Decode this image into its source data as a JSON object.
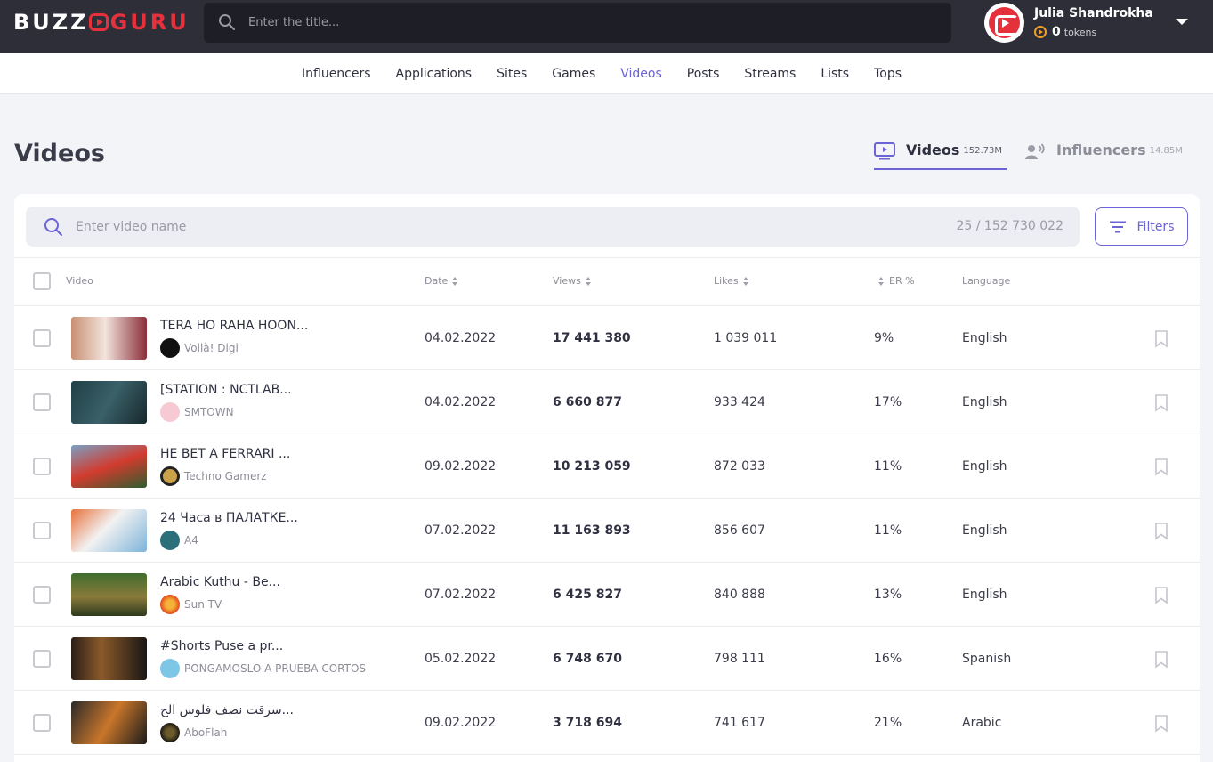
{
  "brand": {
    "part1": "BUZZ",
    "part2": "GURU"
  },
  "top_search": {
    "placeholder": "Enter the title..."
  },
  "user": {
    "name": "Julia Shandrokha",
    "tokens": "0",
    "tokens_label": "tokens"
  },
  "nav": {
    "items": [
      "Influencers",
      "Applications",
      "Sites",
      "Games",
      "Videos",
      "Posts",
      "Streams",
      "Lists",
      "Tops"
    ],
    "active": "Videos"
  },
  "page": {
    "title": "Videos"
  },
  "tabs": {
    "videos": {
      "label": "Videos",
      "count": "152.73M"
    },
    "influencers": {
      "label": "Influencers",
      "count": "14.85M"
    }
  },
  "video_search": {
    "placeholder": "Enter video name",
    "counter": "25 / 152 730 022"
  },
  "filters": {
    "label": "Filters"
  },
  "columns": {
    "video": "Video",
    "date": "Date",
    "views": "Views",
    "likes": "Likes",
    "er": "ER %",
    "language": "Language"
  },
  "rows": [
    {
      "title": "TERA HO RAHA HOON...",
      "channel": "Voilà! Digi",
      "date": "04.02.2022",
      "views": "17 441 380",
      "likes": "1 039 011",
      "er": "9%",
      "language": "English"
    },
    {
      "title": "[STATION : NCTLAB...",
      "channel": "SMTOWN",
      "date": "04.02.2022",
      "views": "6 660 877",
      "likes": "933 424",
      "er": "17%",
      "language": "English"
    },
    {
      "title": "HE BET A FERRARI ...",
      "channel": "Techno Gamerz",
      "date": "09.02.2022",
      "views": "10 213 059",
      "likes": "872 033",
      "er": "11%",
      "language": "English"
    },
    {
      "title": "24 Часа в ПАЛАТКЕ...",
      "channel": "A4",
      "date": "07.02.2022",
      "views": "11 163 893",
      "likes": "856 607",
      "er": "11%",
      "language": "English"
    },
    {
      "title": "Arabic Kuthu - Be...",
      "channel": "Sun TV",
      "date": "07.02.2022",
      "views": "6 425 827",
      "likes": "840 888",
      "er": "13%",
      "language": "English"
    },
    {
      "title": "#Shorts Puse a pr...",
      "channel": "PONGAMOSLO A PRUEBA CORTOS",
      "date": "05.02.2022",
      "views": "6 748 670",
      "likes": "798 111",
      "er": "16%",
      "language": "Spanish"
    },
    {
      "title": "سرقت نصف فلوس الح...",
      "channel": "AboFlah",
      "date": "09.02.2022",
      "views": "3 718 694",
      "likes": "741 617",
      "er": "21%",
      "language": "Arabic"
    }
  ],
  "colors": {
    "accent": "#6b63d6",
    "brand_red": "#e5313b",
    "topbar": "#2d2e38",
    "token": "#f29d2c"
  }
}
